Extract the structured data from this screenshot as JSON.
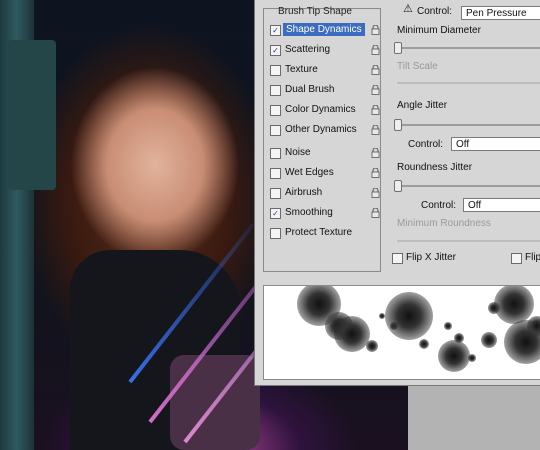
{
  "brush_panel": {
    "section_header": "Brush Tip Shape",
    "items": [
      {
        "label": "Shape Dynamics",
        "checked": true,
        "selected": true
      },
      {
        "label": "Scattering",
        "checked": true,
        "selected": false
      },
      {
        "label": "Texture",
        "checked": false,
        "selected": false
      },
      {
        "label": "Dual Brush",
        "checked": false,
        "selected": false
      },
      {
        "label": "Color Dynamics",
        "checked": false,
        "selected": false
      },
      {
        "label": "Other Dynamics",
        "checked": false,
        "selected": false
      },
      {
        "label": "Noise",
        "checked": false,
        "selected": false
      },
      {
        "label": "Wet Edges",
        "checked": false,
        "selected": false
      },
      {
        "label": "Airbrush",
        "checked": false,
        "selected": false
      },
      {
        "label": "Smoothing",
        "checked": true,
        "selected": false
      },
      {
        "label": "Protect Texture",
        "checked": false,
        "selected": false
      }
    ]
  },
  "shape_dynamics": {
    "control_label": "Control:",
    "control_value": "Pen Pressure",
    "min_diameter_label": "Minimum Diameter",
    "tilt_scale_label": "Tilt Scale",
    "angle_jitter_label": "Angle Jitter",
    "angle_control_label": "Control:",
    "angle_control_value": "Off",
    "roundness_jitter_label": "Roundness Jitter",
    "roundness_control_label": "Control:",
    "roundness_control_value": "Off",
    "min_roundness_label": "Minimum Roundness",
    "flip_x_label": "Flip X Jitter",
    "flip_y_label": "Flip"
  },
  "colors": {
    "selection": "#3c6cc0",
    "panel_bg": "#d6d6d6",
    "check": "#1a3d9a"
  }
}
